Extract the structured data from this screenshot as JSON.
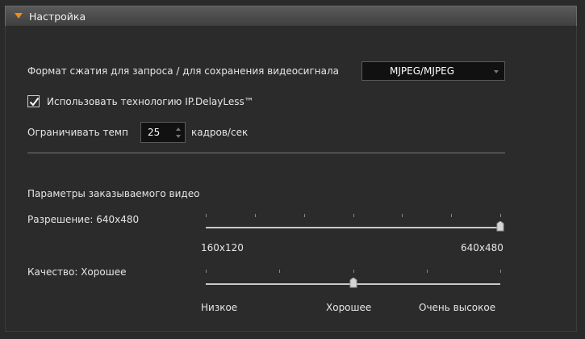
{
  "panel": {
    "title": "Настройка"
  },
  "compression": {
    "label": "Формат сжатия для запроса / для сохранения видеосигнала",
    "value": "MJPEG/MJPEG"
  },
  "delayless": {
    "label": "Использовать технологию IP.DelayLess™",
    "checked": true
  },
  "framerate": {
    "label_before": "Ограничивать темп",
    "value": "25",
    "label_after": "кадров/сек"
  },
  "video_params": {
    "heading": "Параметры заказываемого видео",
    "resolution": {
      "label": "Разрешение: 640x480",
      "min_label": "160x120",
      "max_label": "640x480",
      "steps": 7,
      "position": 1.0
    },
    "quality": {
      "label": "Качество: Хорошее",
      "low_label": "Низкое",
      "mid_label": "Хорошее",
      "high_label": "Очень высокое",
      "steps": 5,
      "position": 0.5
    }
  },
  "colors": {
    "accent": "#f28a18",
    "background": "#2b2b2b"
  }
}
